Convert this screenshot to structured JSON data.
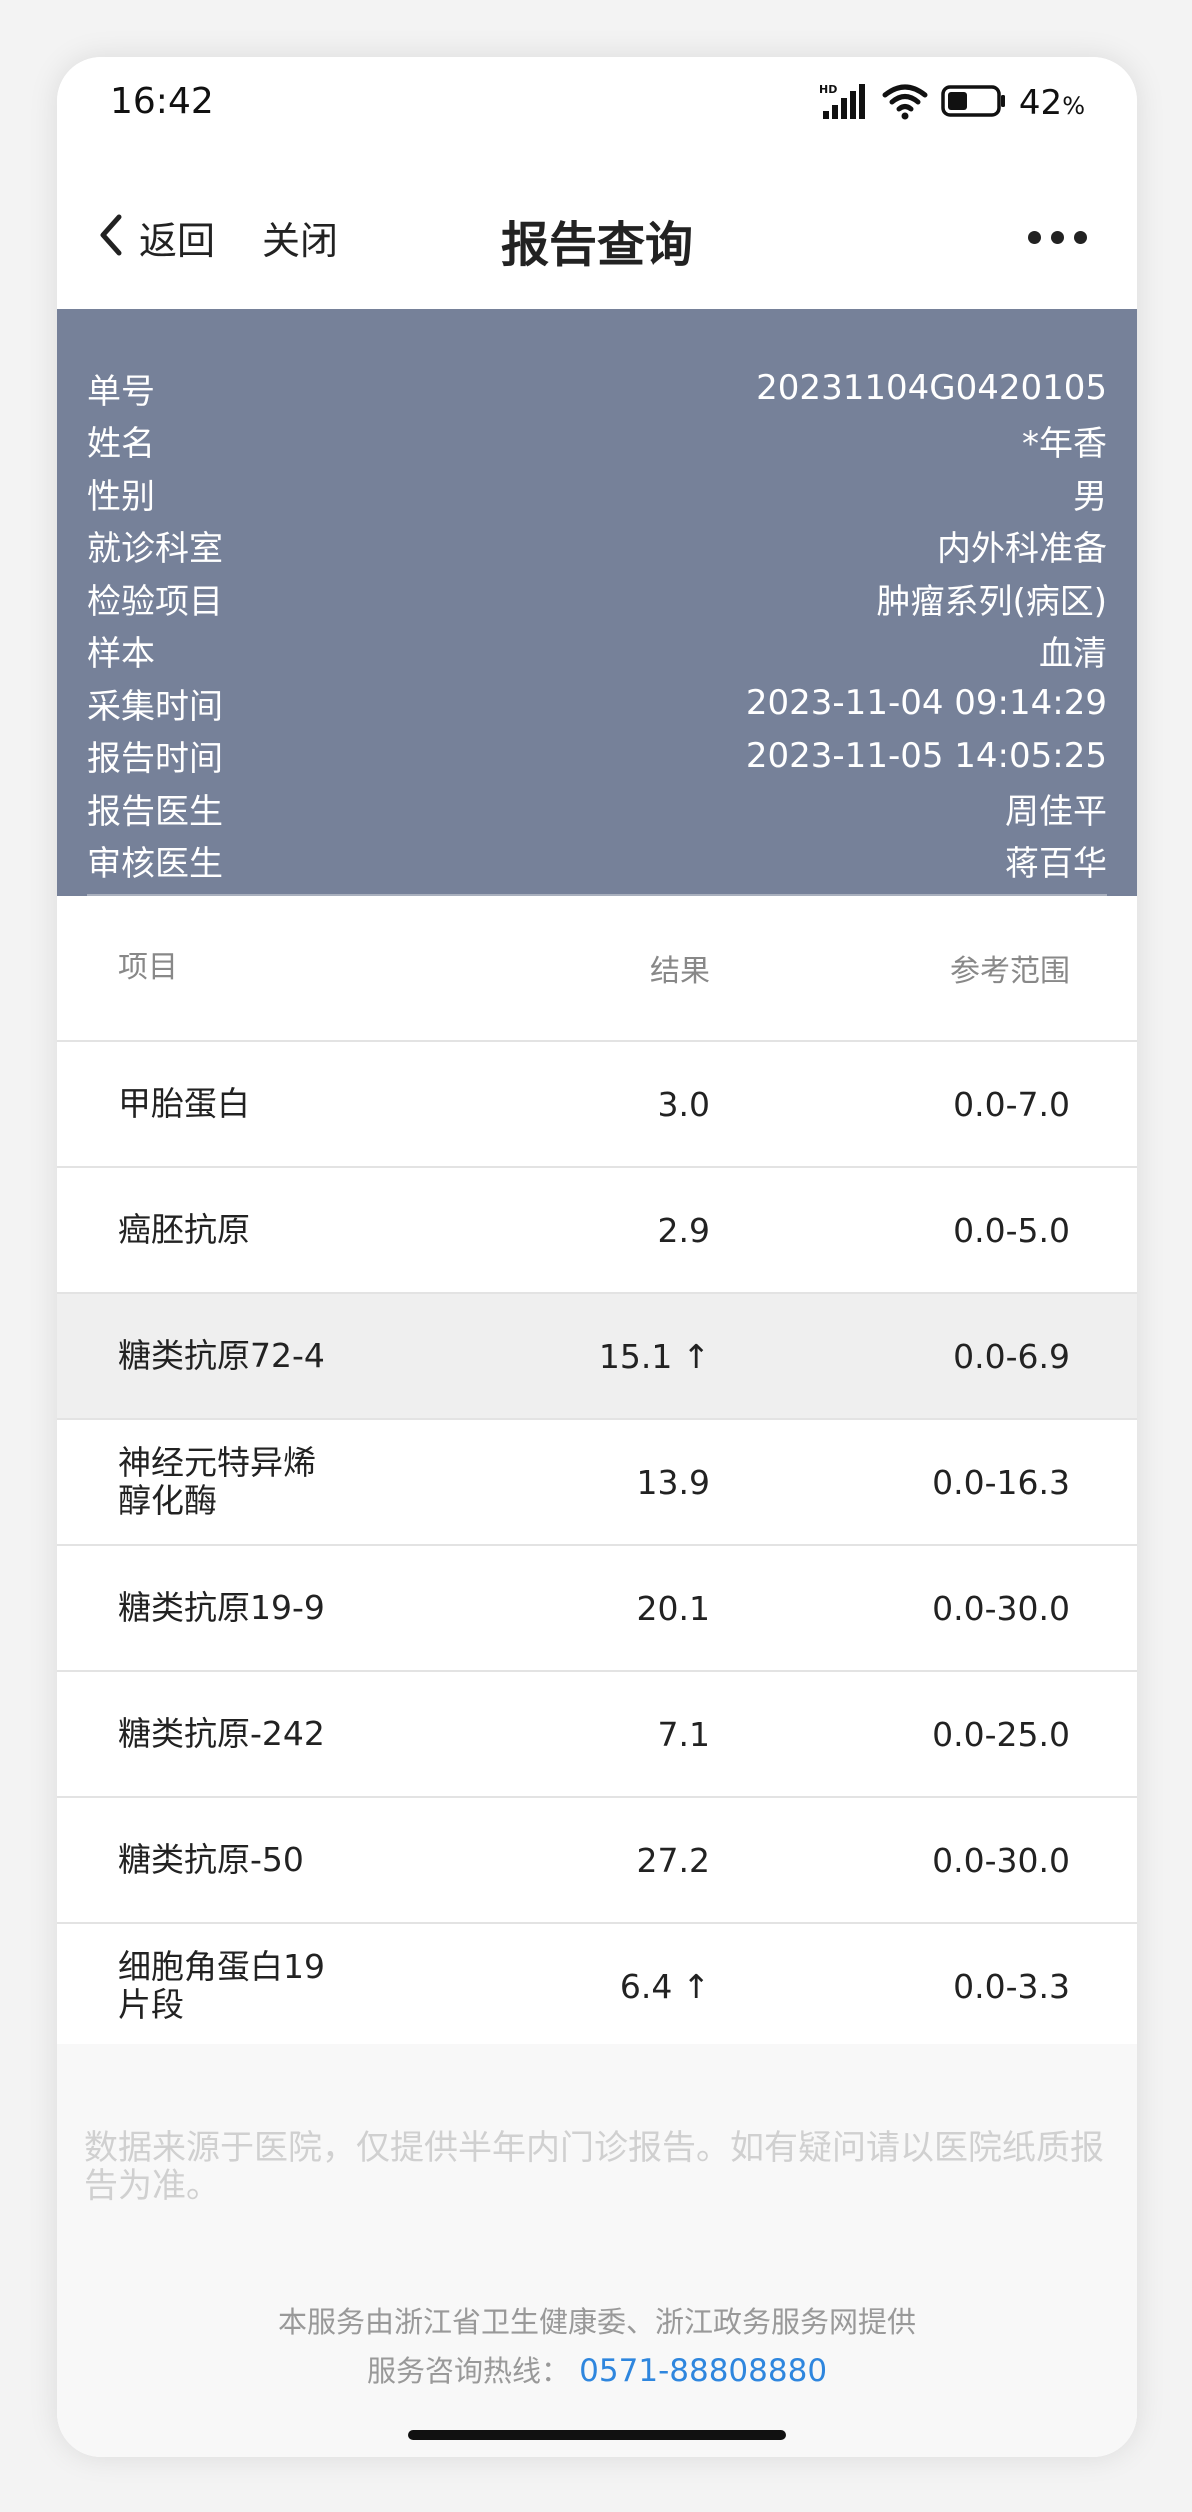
{
  "status_bar": {
    "time": "16:42",
    "battery_value": "42",
    "battery_unit": "%",
    "battery_level": 0.42
  },
  "nav": {
    "back_label": "返回",
    "close_label": "关闭",
    "title": "报告查询"
  },
  "info": [
    {
      "label": "单号",
      "value": "20231104G0420105"
    },
    {
      "label": "姓名",
      "value": "*年香"
    },
    {
      "label": "性别",
      "value": "男"
    },
    {
      "label": "就诊科室",
      "value": "内外科准备"
    },
    {
      "label": "检验项目",
      "value": "肿瘤系列(病区)"
    },
    {
      "label": "样本",
      "value": "血清"
    },
    {
      "label": "采集时间",
      "value": "2023-11-04 09:14:29"
    },
    {
      "label": "报告时间",
      "value": "2023-11-05 14:05:25"
    },
    {
      "label": "报告医生",
      "value": "周佳平"
    },
    {
      "label": "审核医生",
      "value": "蒋百华"
    }
  ],
  "table": {
    "headers": {
      "item": "项目",
      "result": "结果",
      "range": "参考范围"
    },
    "rows": [
      {
        "name_line1": "甲胎蛋白",
        "name_line2": "",
        "result": "3.0",
        "arrow": "",
        "range": "0.0-7.0"
      },
      {
        "name_line1": "癌胚抗原",
        "name_line2": "",
        "result": "2.9",
        "arrow": "",
        "range": "0.0-5.0"
      },
      {
        "name_line1": "糖类抗原72-4",
        "name_line2": "",
        "result": "15.1",
        "arrow": "↑",
        "range": "0.0-6.9"
      },
      {
        "name_line1": "神经元特异烯",
        "name_line2": "醇化酶",
        "result": "13.9",
        "arrow": "",
        "range": "0.0-16.3"
      },
      {
        "name_line1": "糖类抗原19-9",
        "name_line2": "",
        "result": "20.1",
        "arrow": "",
        "range": "0.0-30.0"
      },
      {
        "name_line1": "糖类抗原-242",
        "name_line2": "",
        "result": "7.1",
        "arrow": "",
        "range": "0.0-25.0"
      },
      {
        "name_line1": "糖类抗原-50",
        "name_line2": "",
        "result": "27.2",
        "arrow": "",
        "range": "0.0-30.0"
      },
      {
        "name_line1": "细胞角蛋白19",
        "name_line2": "片段",
        "result": "6.4",
        "arrow": "↑",
        "range": "0.0-3.3"
      }
    ]
  },
  "footer": {
    "disclaimer": "数据来源于医院，仅提供半年内门诊报告。如有疑问请以医院纸质报告为准。",
    "provider": "本服务由浙江省卫生健康委、浙江政务服务网提供",
    "hotline_label": "服务咨询热线：",
    "hotline_number": "0571-88808880"
  },
  "colors": {
    "info_panel_bg": "#768199",
    "abnormal_row_bg": "#efefef",
    "link": "#2e86de"
  }
}
